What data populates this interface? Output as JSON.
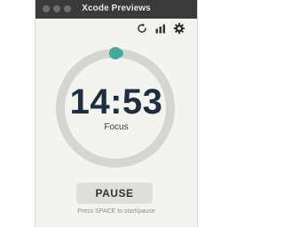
{
  "window": {
    "title": "Xcode Previews"
  },
  "toolbar": {
    "icons": [
      "refresh-icon",
      "stats-icon",
      "gear-icon"
    ]
  },
  "timer": {
    "time": "14:53",
    "mode": "Focus",
    "progress_fraction": 0.01
  },
  "controls": {
    "pause_label": "PAUSE",
    "hint": "Press SPACE to start/pause"
  },
  "colors": {
    "accent": "#45a89b",
    "ring_track": "#d4d6d2",
    "time_text": "#1c2e3f"
  }
}
